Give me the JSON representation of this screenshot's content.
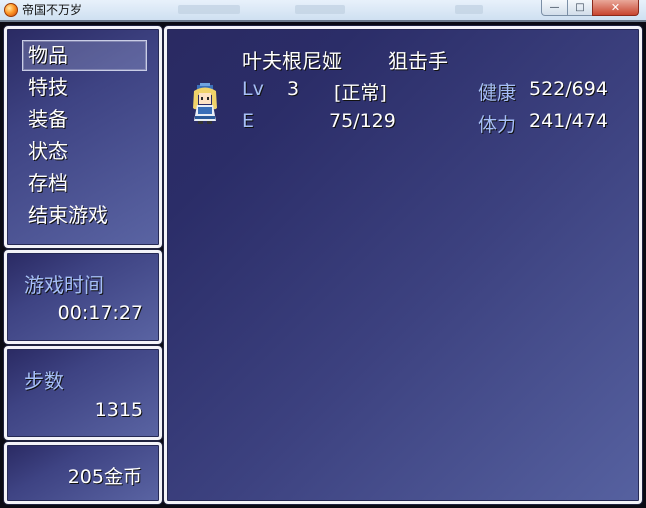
{
  "window": {
    "title": "帝国不万岁",
    "minimize": "—",
    "maximize": "□",
    "close": "✕"
  },
  "menu": {
    "items": [
      "物品",
      "特技",
      "装备",
      "状态",
      "存档",
      "结束游戏"
    ],
    "selected_index": 0
  },
  "playtime": {
    "label": "游戏时间",
    "value": "00:17:27"
  },
  "steps": {
    "label": "步数",
    "value": "1315"
  },
  "gold": {
    "value": "205",
    "unit": "金币"
  },
  "character": {
    "name": "叶夫根尼娅",
    "class": "狙击手",
    "level_label": "Lv",
    "level": "3",
    "status": "[正常]",
    "exp_label": "E",
    "exp": "75/129",
    "hp_label": "健康",
    "hp": "522/694",
    "sp_label": "体力",
    "sp": "241/474"
  },
  "colors": {
    "window_border": "#f3f3f8",
    "window_gradient_dark": "#2a2a63",
    "window_gradient_light": "#5a64a3",
    "label_blue": "#a6bff6"
  },
  "icons": {
    "app": "orange-orb-icon",
    "character": "blonde-girl-sprite-icon"
  }
}
